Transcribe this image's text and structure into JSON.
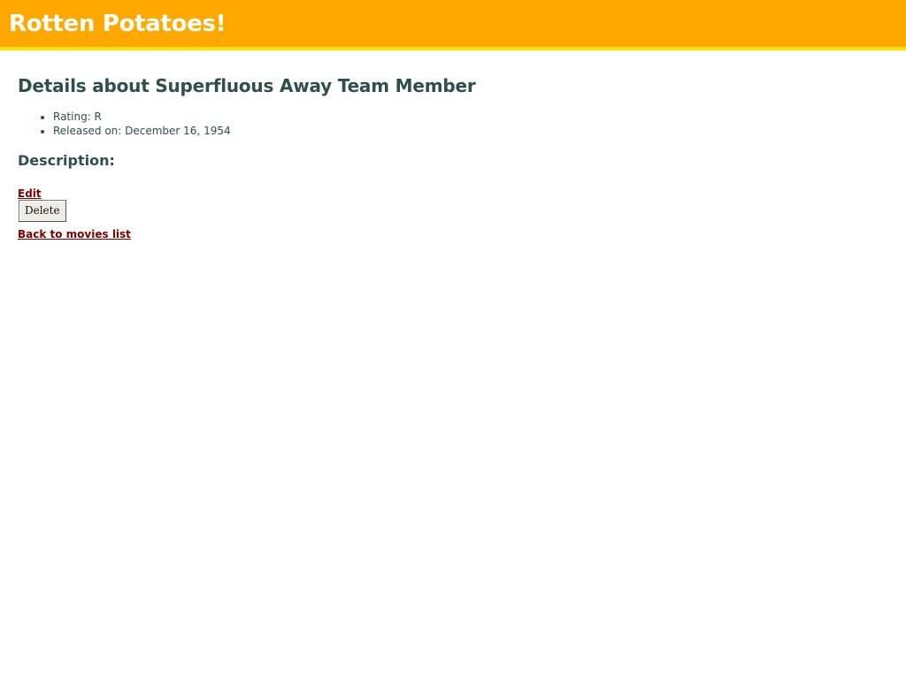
{
  "app": {
    "title": "Rotten Potatoes!"
  },
  "movie": {
    "heading": "Details about Superfluous Away Team Member",
    "details": [
      "Rating: R",
      "Released on: December 16, 1954"
    ],
    "description_heading": "Description:"
  },
  "actions": {
    "edit_label": "Edit",
    "delete_label": "Delete",
    "back_label": "Back to movies list"
  },
  "colors": {
    "header_background": "#ffa800",
    "header_border": "#ffe100",
    "text_heading": "#2f4f4f",
    "link": "#800000"
  }
}
